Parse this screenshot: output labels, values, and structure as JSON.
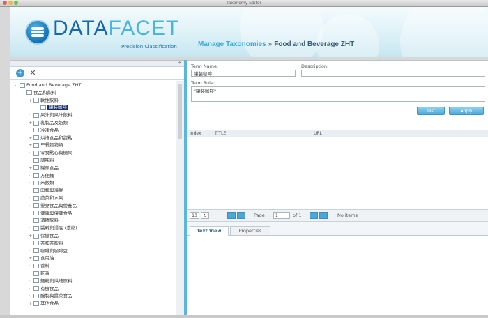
{
  "window": {
    "title": "Taxonomy Editor"
  },
  "brand": {
    "logo_part1": "DATA",
    "logo_part2": "FACET",
    "tagline": "Precision Classification"
  },
  "breadcrumb": {
    "parent": "Manage Taxonomies",
    "separator": "»",
    "current": "Food and Beverage ZHT"
  },
  "tree": {
    "root": "Food and Beverage ZHT",
    "items": [
      {
        "label": "食品和飲料",
        "exp": "-",
        "indent": 1
      },
      {
        "label": "軟性飲料",
        "exp": "+",
        "indent": 2
      },
      {
        "label": "罐裝咖啡",
        "exp": "",
        "indent": 3,
        "selected": true
      },
      {
        "label": "果汁與果汁飲料",
        "exp": "",
        "indent": 2
      },
      {
        "label": "乳製品及奶類",
        "exp": "+",
        "indent": 2
      },
      {
        "label": "冷凍食品",
        "exp": "",
        "indent": 2
      },
      {
        "label": "烘焙食品和甜點",
        "exp": "+",
        "indent": 2
      },
      {
        "label": "早餐穀物類",
        "exp": "+",
        "indent": 2
      },
      {
        "label": "零食點心與糖果",
        "exp": "",
        "indent": 2
      },
      {
        "label": "調味料",
        "exp": "",
        "indent": 2
      },
      {
        "label": "罐頭食品",
        "exp": "+",
        "indent": 2
      },
      {
        "label": "方便麵",
        "exp": "",
        "indent": 2
      },
      {
        "label": "米飯類",
        "exp": "",
        "indent": 2
      },
      {
        "label": "肉類與海鮮",
        "exp": "",
        "indent": 2
      },
      {
        "label": "蔬菜和水果",
        "exp": "",
        "indent": 2
      },
      {
        "label": "嬰兒食品與營養品",
        "exp": "",
        "indent": 2
      },
      {
        "label": "健康與保健食品",
        "exp": "",
        "indent": 2
      },
      {
        "label": "酒精飲料",
        "exp": "",
        "indent": 2
      },
      {
        "label": "醬料與湯底 (濃縮)",
        "exp": "",
        "indent": 2
      },
      {
        "label": "保健食品",
        "exp": "+",
        "indent": 2
      },
      {
        "label": "茶和茶飲料",
        "exp": "",
        "indent": 2
      },
      {
        "label": "咖啡與咖啡豆",
        "exp": "",
        "indent": 2
      },
      {
        "label": "食用油",
        "exp": "+",
        "indent": 2
      },
      {
        "label": "香料",
        "exp": "",
        "indent": 2
      },
      {
        "label": "乾貨",
        "exp": "",
        "indent": 2
      },
      {
        "label": "麵粉與烘焙原料",
        "exp": "",
        "indent": 2
      },
      {
        "label": "有機食品",
        "exp": "",
        "indent": 2
      },
      {
        "label": "醃製與醬菜食品",
        "exp": "",
        "indent": 2
      },
      {
        "label": "其他食品",
        "exp": "+",
        "indent": 2
      }
    ]
  },
  "form": {
    "term_name_label": "Term Name:",
    "term_name_value": "罐裝咖啡",
    "description_label": "Description:",
    "description_value": "",
    "term_rule_label": "Term Rule:",
    "term_rule_value": "\"罐裝咖啡\"",
    "test_button": "Test",
    "apply_button": "Apply"
  },
  "grid": {
    "columns": [
      "Index",
      "TITLE",
      "URL"
    ]
  },
  "pager": {
    "page_label": "Page",
    "page_value": "1",
    "of_label": "of 1",
    "status": "No items"
  },
  "tabs": [
    {
      "label": "Text View",
      "active": true
    },
    {
      "label": "Properties",
      "active": false
    }
  ],
  "colors": {
    "accent": "#5bb6dc",
    "selection": "#1b2f6e",
    "brand_dark": "#1368ad",
    "brand_light": "#48b4e0"
  }
}
